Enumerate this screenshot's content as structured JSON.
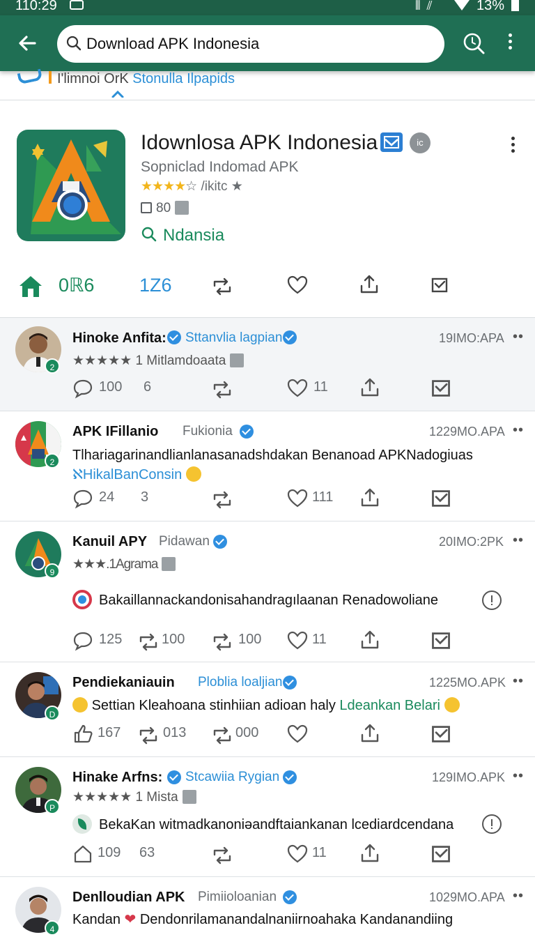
{
  "status_bar": {
    "time": "110:29",
    "battery": "13%"
  },
  "search": {
    "value": "Download APK Indonesia"
  },
  "subtitle_strip": {
    "text_a": "I'limnoi OrK ",
    "text_b": "Stonulla Ilpapids"
  },
  "app_card": {
    "title": "Idownlosa APK Indonesia",
    "developer": "Sopniclad Indomad APK",
    "stars": "★★★★",
    "rating_text": "☆ /ikitc ★",
    "size": "80",
    "region": "Ndansia",
    "count_left": "0ℝ6",
    "count_right": "1Z6",
    "verified_badge": "ic"
  },
  "posts": [
    {
      "name": "Hinoke Anfita:",
      "handle": "Sttanvlia lagpian",
      "time": "19IMO:APA",
      "line": "★★★★★ 1 Mitlamdoaata",
      "replies": "100",
      "retweets": "6",
      "likes": "11",
      "avatar_badge": "2"
    },
    {
      "name": "APK IFillanio",
      "handle": "Fukionia",
      "time": "1229MO.APA",
      "body_a": "Tlhariagarinandlianlanasanadshdakan Benanoad APK",
      "body_b": "Nadogiuas",
      "body_c": "ℵHikalBanConsin",
      "replies": "24",
      "retweets": "3",
      "likes": "111",
      "avatar_badge": "2"
    },
    {
      "name": "Kanuil APY",
      "handle": "Pidawan",
      "time": "20IMO:2PK",
      "line": "★★★.1Agrama",
      "body": "Bakaillannackandonisahandragılaanan Renadowoliane",
      "replies": "125",
      "retweets": "100",
      "quotes": "100",
      "likes": "11",
      "avatar_badge": "9"
    },
    {
      "name": "Pendiekaniauin",
      "handle": "Ploblia loaljian",
      "time": "1225MO.APK",
      "body_a": "Settian Kleahoana stinhiian adioan haly ",
      "body_b": "Ldeankan Belari",
      "replies": "167",
      "retweets": "013",
      "quotes": "000",
      "avatar_badge": "D"
    },
    {
      "name": "Hinake Arfns:",
      "handle": "Stcawiia Rygian",
      "time": "129IMO.APK",
      "line": "★★★★★ 1 Mista",
      "body": "BekaKan witmadkanoniəandftaiankanan lcediardcendana",
      "replies": "109",
      "retweets": "63",
      "likes": "11",
      "avatar_badge": "P"
    },
    {
      "name": "Denlloudian APK",
      "handle": "Pimiioloanian",
      "time": "1029MO.APA",
      "body_a": "Kandan ",
      "body_b": " Dendonrilamanandalnaniirnoahaka Kandanandiing",
      "avatar_badge": "4"
    }
  ],
  "colors": {
    "app_bar": "#1f6f54",
    "status_bar": "#1e5f47",
    "accent_green": "#1a8a5c",
    "link_blue": "#2c8fd6",
    "star_yellow": "#f2b51b"
  },
  "icons": [
    "back-arrow-icon",
    "search-icon",
    "more-vert-icon",
    "home-icon",
    "retweet-icon",
    "heart-icon",
    "share-icon",
    "bookmark-icon",
    "reply-icon",
    "info-icon",
    "verified-icon"
  ]
}
